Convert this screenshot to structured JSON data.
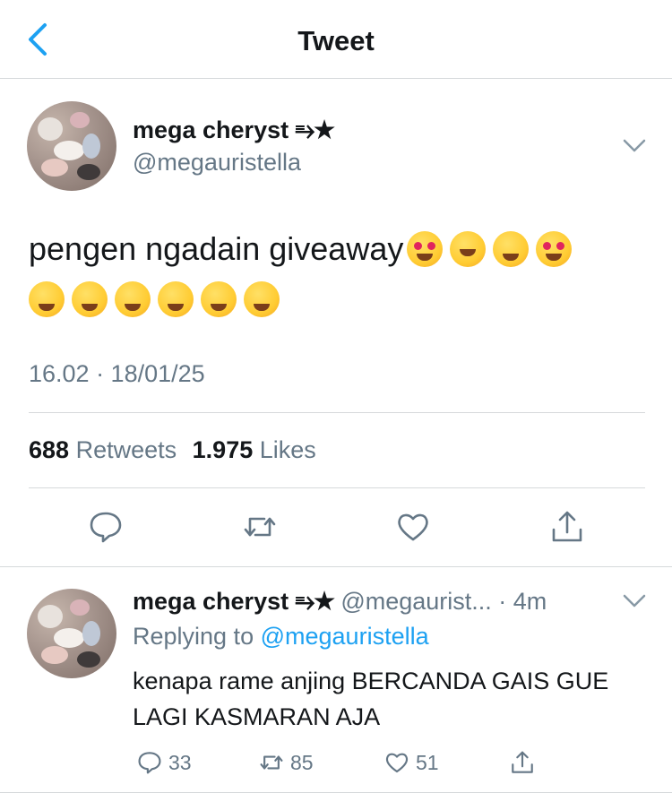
{
  "header": {
    "title": "Tweet"
  },
  "tweet": {
    "author_name": "mega cheryst ⥱★",
    "author_handle": "@megauristella",
    "text": "pengen ngadain giveaway",
    "timestamp": "16.02 · 18/01/25",
    "retweets_count": "688",
    "retweets_label": "Retweets",
    "likes_count": "1.975",
    "likes_label": "Likes"
  },
  "reply": {
    "author_name": "mega cheryst ⥱★",
    "author_handle": "@megaurist...",
    "time": "· 4m",
    "replying_prefix": "Replying to",
    "replying_handle": "@megauristella",
    "text": "kenapa rame anjing BERCANDA GAIS GUE LAGI KASMARAN AJA",
    "reply_count": "33",
    "retweet_count": "85",
    "like_count": "51"
  },
  "colors": {
    "accent": "#1da1f2",
    "text": "#14171a",
    "muted": "#657786",
    "divider": "#d6d9db"
  },
  "icons": {
    "back": "chevron-left-icon",
    "more": "chevron-down-icon",
    "reply": "comment-icon",
    "retweet": "retweet-icon",
    "like": "heart-icon",
    "share": "share-icon",
    "emoji": "emoji-icon"
  }
}
